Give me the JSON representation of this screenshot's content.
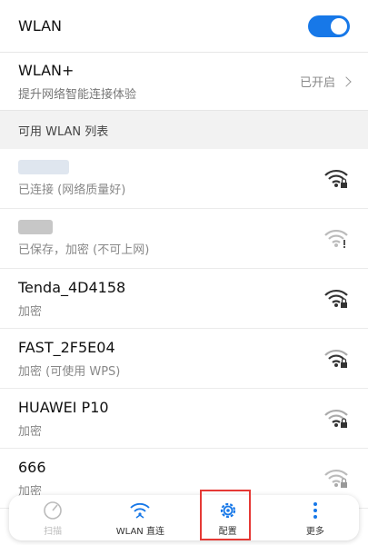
{
  "wlan": {
    "title": "WLAN",
    "enabled": true
  },
  "wlan_plus": {
    "title": "WLAN+",
    "subtitle": "提升网络智能连接体验",
    "status": "已开启"
  },
  "section": {
    "title": "可用 WLAN 列表"
  },
  "networks": [
    {
      "name": "",
      "status": "已连接 (网络质量好)",
      "icon": "wifi-locked-icon"
    },
    {
      "name": "",
      "status": "已保存，加密 (不可上网)",
      "icon": "wifi-warning-icon"
    },
    {
      "name": "Tenda_4D4158",
      "status": "加密",
      "icon": "wifi-locked-icon"
    },
    {
      "name": "FAST_2F5E04",
      "status": "加密 (可使用 WPS)",
      "icon": "wifi-locked-icon"
    },
    {
      "name": "HUAWEI P10",
      "status": "加密",
      "icon": "wifi-locked-icon"
    },
    {
      "name": "666",
      "status": "加密",
      "icon": "wifi-locked-icon"
    }
  ],
  "bottom_bar": {
    "items": [
      {
        "label": "扫描",
        "icon": "scan-icon"
      },
      {
        "label": "WLAN 直连",
        "icon": "wifi-direct-icon"
      },
      {
        "label": "配置",
        "icon": "gear-icon"
      },
      {
        "label": "更多",
        "icon": "more-vertical-icon"
      }
    ]
  },
  "colors": {
    "accent": "#1778e8",
    "highlight": "#e53935"
  }
}
